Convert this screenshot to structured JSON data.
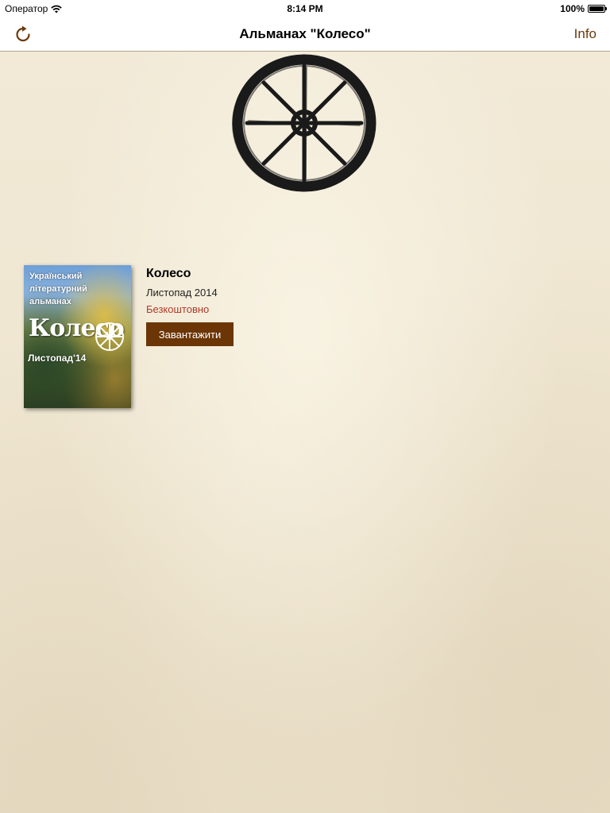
{
  "status_bar": {
    "carrier": "Оператор",
    "time": "8:14 PM",
    "battery": "100%"
  },
  "nav": {
    "title": "Альманах \"Колесо\"",
    "info_label": "Info",
    "refresh_icon": "refresh-icon"
  },
  "logo": {
    "icon": "wagon-wheel-icon"
  },
  "issue": {
    "cover": {
      "line1": "Український",
      "line2": "літературний",
      "line3": "альманах",
      "title": "Колесо",
      "date": "Листопад'14"
    },
    "title": "Колесо",
    "date": "Листопад 2014",
    "price": "Безкоштовно",
    "download_label": "Завантажити"
  },
  "colors": {
    "accent": "#6b3506",
    "price": "#b03a2a",
    "background": "#f1e9d6"
  }
}
